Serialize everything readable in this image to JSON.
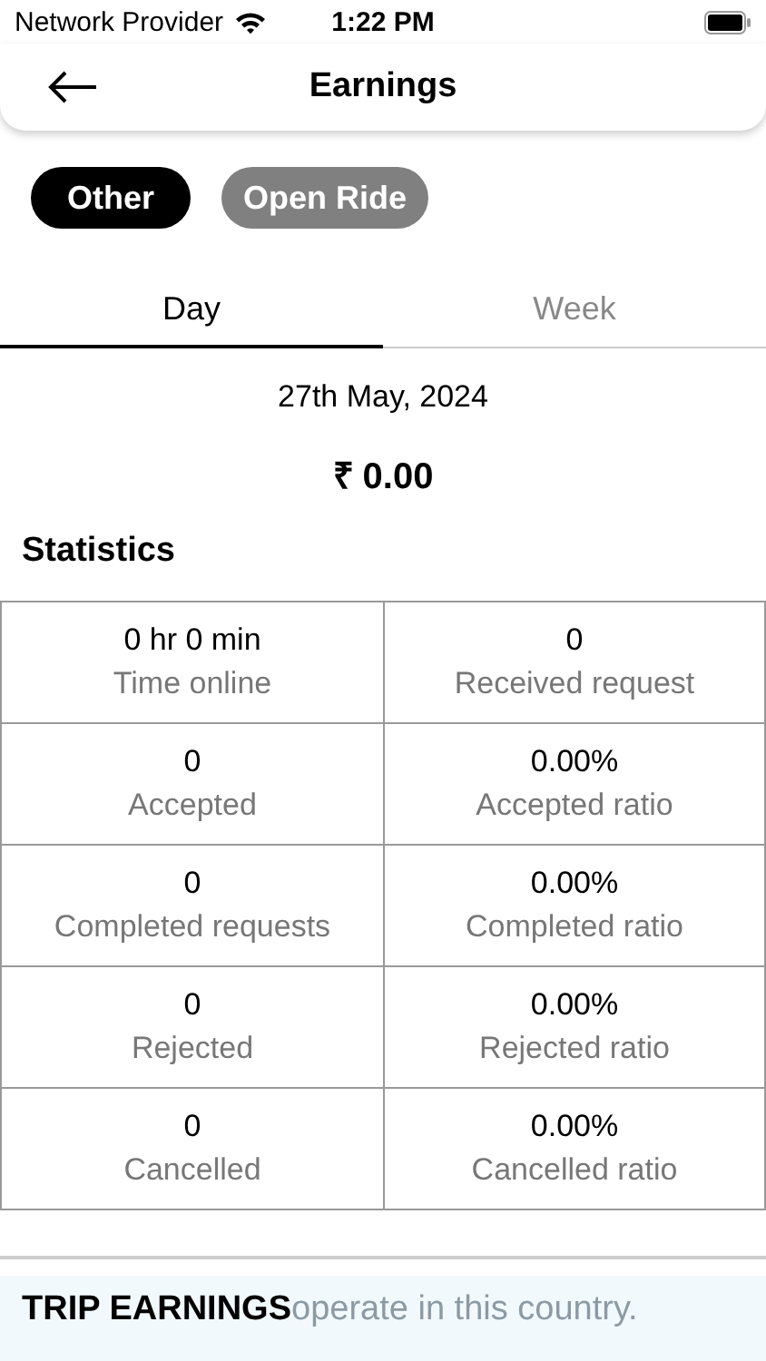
{
  "status_bar": {
    "carrier": "Network Provider",
    "time": "1:22 PM"
  },
  "header": {
    "title": "Earnings"
  },
  "filters": [
    {
      "label": "Other",
      "selected": true
    },
    {
      "label": "Open Ride",
      "selected": false
    }
  ],
  "tabs": [
    {
      "label": "Day",
      "selected": true
    },
    {
      "label": "Week",
      "selected": false
    }
  ],
  "date": "27th May, 2024",
  "amount": "₹ 0.00",
  "statistics": {
    "title": "Statistics",
    "cells": [
      {
        "value": "0 hr 0 min",
        "label": "Time online"
      },
      {
        "value": "0",
        "label": "Received request"
      },
      {
        "value": "0",
        "label": "Accepted"
      },
      {
        "value": "0.00%",
        "label": "Accepted ratio"
      },
      {
        "value": "0",
        "label": "Completed requests"
      },
      {
        "value": "0.00%",
        "label": "Completed ratio"
      },
      {
        "value": "0",
        "label": "Rejected"
      },
      {
        "value": "0.00%",
        "label": "Rejected ratio"
      },
      {
        "value": "0",
        "label": "Cancelled"
      },
      {
        "value": "0.00%",
        "label": "Cancelled ratio"
      }
    ]
  },
  "trip_earnings": {
    "title": "TRIP EARNINGS",
    "toast": "operate in this country."
  }
}
